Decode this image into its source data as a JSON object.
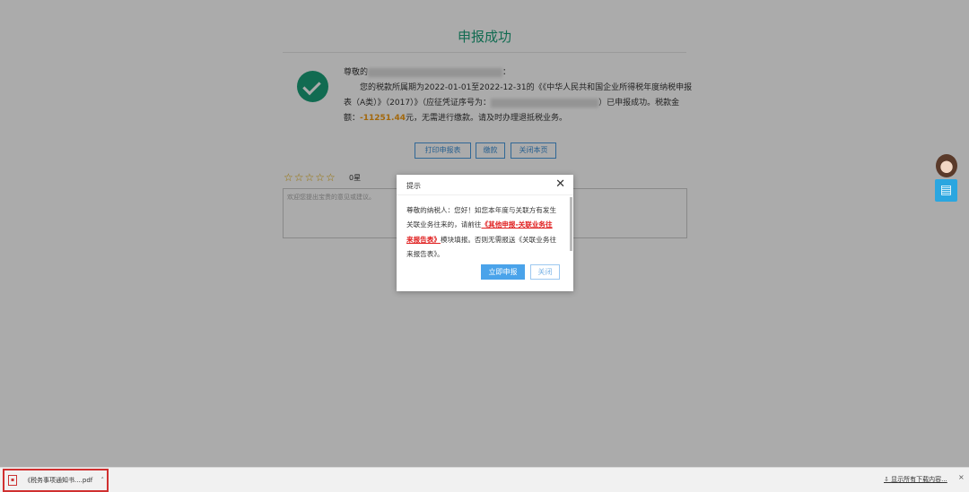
{
  "page": {
    "title": "申报成功",
    "greeting": "尊敬的",
    "greeting_end": "：",
    "msg_part1": "您的税款所属期为2022-01-01至2022-12-31的《《中华人民共和国企业所得税年度纳税申报表（A类）》（2017）》（应征凭证序号为：",
    "msg_part2": "）已申报成功。税款金额：",
    "amount": "-11251.44",
    "msg_part3": "元，无需进行缴款。请及时办理退抵税业务。",
    "buttons": {
      "print": "打印申报表",
      "pay": "缴款",
      "close": "关闭本页"
    },
    "rating": {
      "stars": 0,
      "max": 5,
      "label": "0星"
    },
    "feedback_placeholder": "欢迎您提出宝贵的意见或建议。"
  },
  "dialog": {
    "title": "提示",
    "text1": "尊敬的纳税人：您好！如您本年度与关联方有发生关联业务往来的，请前往",
    "link": "《其他申报-关联业务往来报告表》",
    "text2": "模块填报。否则无需报送《关联业务往来报告表》。",
    "confirm": "立即申报",
    "cancel": "关闭"
  },
  "side": {
    "icon": "Ⓑ"
  },
  "downloads": {
    "file": "《税务事项通知书....pdf",
    "show_all": "显示所有下载内容...",
    "close": "×"
  },
  "colors": {
    "accent": "#1aa07a",
    "amount": "#f39c12",
    "link": "#e02020",
    "primary": "#4aa3ea"
  }
}
